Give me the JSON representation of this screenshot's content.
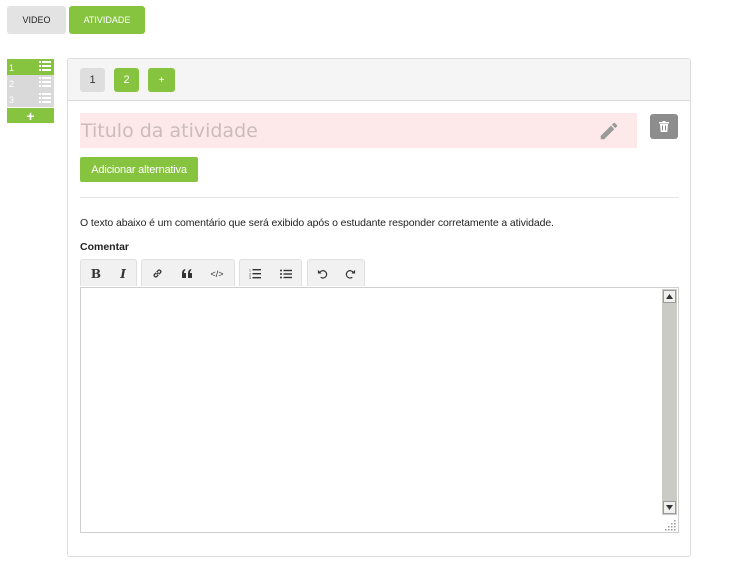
{
  "top_tabs": {
    "video": "VIDEO",
    "atividade": "ATIVIDADE"
  },
  "sidebar": {
    "items": [
      {
        "number": "1",
        "state": "active"
      },
      {
        "number": "2",
        "state": "inactive"
      },
      {
        "number": "3",
        "state": "inactive"
      }
    ],
    "add_label": "+"
  },
  "panel": {
    "pages": [
      "1",
      "2"
    ],
    "add_page_label": "+",
    "title_placeholder": "Titulo da atividade",
    "add_alternative_label": "Adicionar alternativa",
    "info_text": "O texto abaixo é um comentário que será exibido após o estudante responder corretamente a atividade.",
    "comment_label": "Comentar",
    "editor_value": ""
  },
  "colors": {
    "accent": "#86c440",
    "title_bg": "#fde9e9",
    "delete_button": "#8d8d8d"
  },
  "icons": {
    "toolbar": [
      "bold-icon",
      "italic-icon",
      "link-icon",
      "quote-icon",
      "code-icon",
      "ordered-list-icon",
      "unordered-list-icon",
      "undo-icon",
      "redo-icon"
    ]
  }
}
